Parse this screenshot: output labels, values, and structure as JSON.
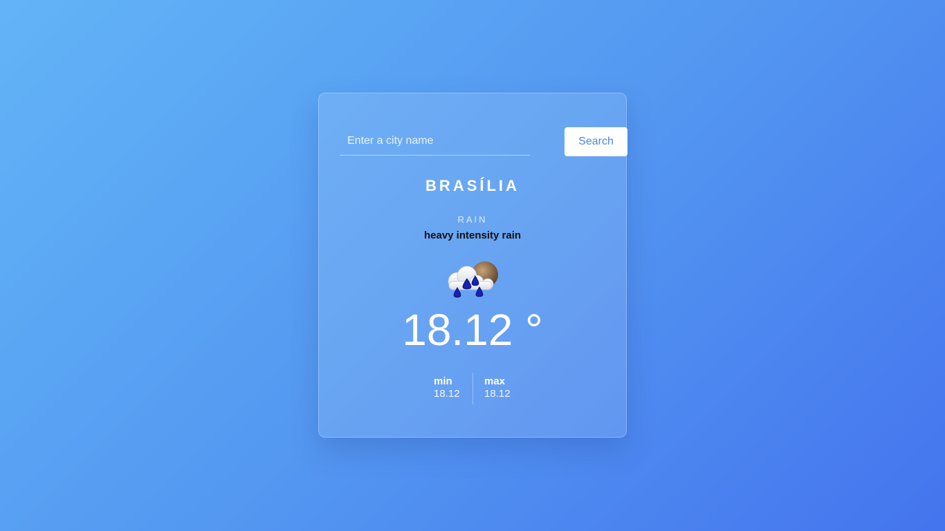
{
  "search": {
    "placeholder": "Enter a city name",
    "value": "",
    "button_label": "Search"
  },
  "weather": {
    "city": "BRASÍLIA",
    "main": "RAIN",
    "description": "heavy intensity rain",
    "icon": "heavy-rain-cloud-moon-icon",
    "temperature": "18.12 °",
    "min_label": "min",
    "min_value": "18.12",
    "max_label": "max",
    "max_value": "18.12"
  },
  "colors": {
    "background_start": "#62b4f7",
    "background_end": "#4474ee",
    "button_text": "#4a86e8",
    "description_text": "#111111"
  }
}
